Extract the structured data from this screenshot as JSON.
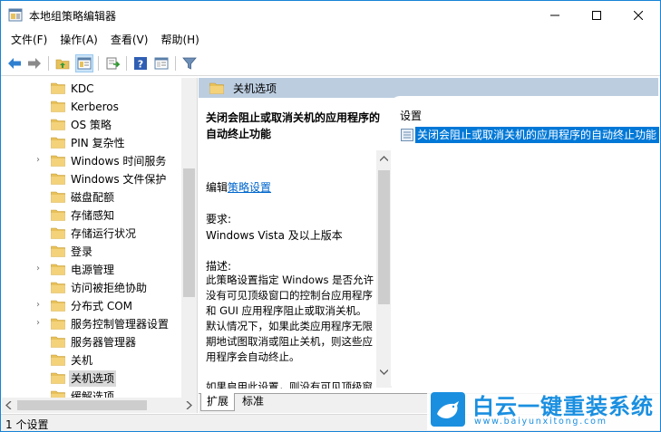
{
  "window": {
    "title": "本地组策略编辑器"
  },
  "menu": [
    "文件(F)",
    "操作(A)",
    "查看(V)",
    "帮助(H)"
  ],
  "tree": {
    "items": [
      {
        "label": "KDC",
        "expandable": false,
        "selected": false
      },
      {
        "label": "Kerberos",
        "expandable": false,
        "selected": false
      },
      {
        "label": "OS 策略",
        "expandable": false,
        "selected": false
      },
      {
        "label": "PIN 复杂性",
        "expandable": false,
        "selected": false
      },
      {
        "label": "Windows 时间服务",
        "expandable": true,
        "selected": false
      },
      {
        "label": "Windows 文件保护",
        "expandable": false,
        "selected": false
      },
      {
        "label": "磁盘配额",
        "expandable": false,
        "selected": false
      },
      {
        "label": "存储感知",
        "expandable": false,
        "selected": false
      },
      {
        "label": "存储运行状况",
        "expandable": false,
        "selected": false
      },
      {
        "label": "登录",
        "expandable": false,
        "selected": false
      },
      {
        "label": "电源管理",
        "expandable": true,
        "selected": false
      },
      {
        "label": "访问被拒绝协助",
        "expandable": false,
        "selected": false
      },
      {
        "label": "分布式 COM",
        "expandable": true,
        "selected": false
      },
      {
        "label": "服务控制管理器设置",
        "expandable": true,
        "selected": false
      },
      {
        "label": "服务器管理器",
        "expandable": false,
        "selected": false
      },
      {
        "label": "关机",
        "expandable": false,
        "selected": false
      },
      {
        "label": "关机选项",
        "expandable": false,
        "selected": true
      },
      {
        "label": "缓解选项",
        "expandable": false,
        "selected": false
      }
    ]
  },
  "header": {
    "title": "关机选项"
  },
  "description": {
    "title": "关闭会阻止或取消关机的应用程序的自动终止功能",
    "edit_prefix": "编辑",
    "edit_link": "策略设置",
    "requirements_heading": "要求:",
    "requirements": "Windows Vista 及以上版本",
    "description_heading": "描述:",
    "description_text": "此策略设置指定 Windows 是否允许没有可见顶级窗口的控制台应用程序和 GUI 应用程序阻止或取消关机。默认情况下，如果此类应用程序无限期地试图取消或阻止关机，则这些应用程序会自动终止。",
    "description_text_2": "如果启用此设置，则没有可见顶级窗口且阻止或取消关机的控制台应"
  },
  "settings": {
    "heading": "设置",
    "rows": [
      {
        "label": "关闭会阻止或取消关机的应用程序的自动终止功能"
      }
    ]
  },
  "tabs": [
    {
      "label": "扩展",
      "active": true
    },
    {
      "label": "标准",
      "active": false
    }
  ],
  "status": {
    "text": "1 个设置"
  },
  "watermark": {
    "text_cn": "白云一键重装系统",
    "text_en": "www.baiyunxitong.com"
  },
  "colors": {
    "accent": "#0078d7",
    "header_bar": "#bccde0",
    "folder": "#e8c15a",
    "watermark": "#1a8fe0"
  }
}
